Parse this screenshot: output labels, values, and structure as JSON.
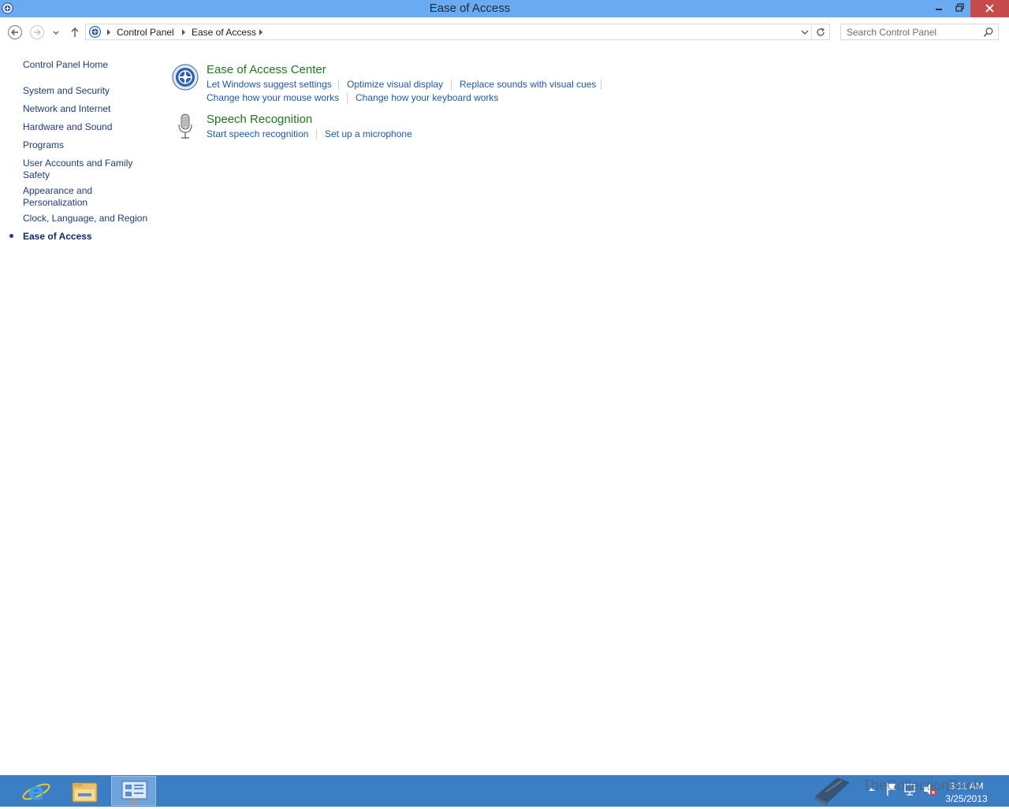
{
  "window": {
    "title": "Ease of Access"
  },
  "address": {
    "crumbs": [
      "Control Panel",
      "Ease of Access"
    ]
  },
  "search": {
    "placeholder": "Search Control Panel"
  },
  "leftnav": {
    "home": "Control Panel Home",
    "items": [
      "System and Security",
      "Network and Internet",
      "Hardware and Sound",
      "Programs",
      "User Accounts and Family",
      "Safety",
      "Appearance and",
      "Personalization",
      "Clock, Language, and Region",
      "Ease of Access"
    ]
  },
  "categories": [
    {
      "title": "Ease of Access Center",
      "icon": "ease-of-access-icon",
      "tasks": [
        "Let Windows suggest settings",
        "Optimize visual display",
        "Replace sounds with visual cues",
        "Change how your mouse works",
        "Change how your keyboard works"
      ]
    },
    {
      "title": "Speech Recognition",
      "icon": "microphone-icon",
      "tasks": [
        "Start speech recognition",
        "Set up a microphone"
      ]
    }
  ],
  "taskbar": {
    "time": "3:11 AM",
    "date": "3/25/2013"
  },
  "watermark": {
    "text": "TheCollectionBook"
  },
  "colors": {
    "titlebar": "#6aaaf0",
    "taskbar": "#3c7ec4",
    "link": "#1e5aa0",
    "category": "#1b7a1b",
    "close": "#c74b4b"
  }
}
